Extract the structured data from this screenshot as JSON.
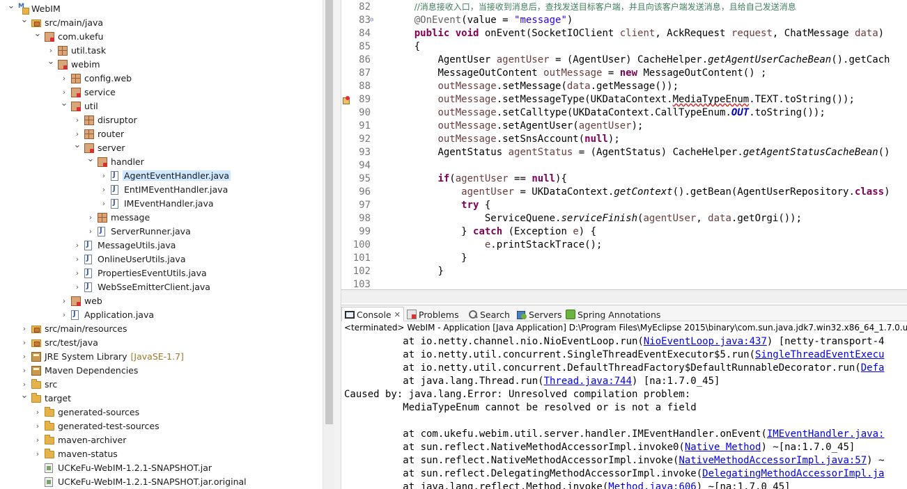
{
  "explorer": {
    "rows": [
      {
        "label": "WebIM",
        "depth": 0,
        "arrow": "open",
        "icon": "project"
      },
      {
        "label": "src/main/java",
        "depth": 1,
        "arrow": "open",
        "icon": "srcfolder"
      },
      {
        "label": "com.ukefu",
        "depth": 2,
        "arrow": "open",
        "icon": "pkgx"
      },
      {
        "label": "util.task",
        "depth": 3,
        "arrow": "closed",
        "icon": "pkg"
      },
      {
        "label": "webim",
        "depth": 3,
        "arrow": "open",
        "icon": "pkgx"
      },
      {
        "label": "config.web",
        "depth": 4,
        "arrow": "closed",
        "icon": "pkg"
      },
      {
        "label": "service",
        "depth": 4,
        "arrow": "closed",
        "icon": "pkgx"
      },
      {
        "label": "util",
        "depth": 4,
        "arrow": "open",
        "icon": "pkgx"
      },
      {
        "label": "disruptor",
        "depth": 5,
        "arrow": "closed",
        "icon": "pkg"
      },
      {
        "label": "router",
        "depth": 5,
        "arrow": "closed",
        "icon": "pkg"
      },
      {
        "label": "server",
        "depth": 5,
        "arrow": "open",
        "icon": "pkgx"
      },
      {
        "label": "handler",
        "depth": 6,
        "arrow": "open",
        "icon": "pkgx"
      },
      {
        "label": "AgentEventHandler.java",
        "depth": 7,
        "arrow": "closed",
        "icon": "java",
        "selected": true
      },
      {
        "label": "EntIMEventHandler.java",
        "depth": 7,
        "arrow": "closed",
        "icon": "java"
      },
      {
        "label": "IMEventHandler.java",
        "depth": 7,
        "arrow": "closed",
        "icon": "java"
      },
      {
        "label": "message",
        "depth": 6,
        "arrow": "closed",
        "icon": "pkg"
      },
      {
        "label": "ServerRunner.java",
        "depth": 6,
        "arrow": "closed",
        "icon": "java"
      },
      {
        "label": "MessageUtils.java",
        "depth": 5,
        "arrow": "closed",
        "icon": "java"
      },
      {
        "label": "OnlineUserUtils.java",
        "depth": 5,
        "arrow": "closed",
        "icon": "java"
      },
      {
        "label": "PropertiesEventUtils.java",
        "depth": 5,
        "arrow": "closed",
        "icon": "java"
      },
      {
        "label": "WebSseEmitterClient.java",
        "depth": 5,
        "arrow": "closed",
        "icon": "java"
      },
      {
        "label": "web",
        "depth": 4,
        "arrow": "closed",
        "icon": "pkgx"
      },
      {
        "label": "Application.java",
        "depth": 4,
        "arrow": "closed",
        "icon": "java"
      },
      {
        "label": "src/main/resources",
        "depth": 1,
        "arrow": "closed",
        "icon": "srcfolder"
      },
      {
        "label": "src/test/java",
        "depth": 1,
        "arrow": "closed",
        "icon": "srcfolder"
      },
      {
        "label": "JRE System Library",
        "decoration": "[JavaSE-1.7]",
        "depth": 1,
        "arrow": "closed",
        "icon": "lib"
      },
      {
        "label": "Maven Dependencies",
        "depth": 1,
        "arrow": "closed",
        "icon": "lib"
      },
      {
        "label": "src",
        "depth": 1,
        "arrow": "closed",
        "icon": "folder"
      },
      {
        "label": "target",
        "depth": 1,
        "arrow": "open",
        "icon": "folder"
      },
      {
        "label": "generated-sources",
        "depth": 2,
        "arrow": "closed",
        "icon": "folder"
      },
      {
        "label": "generated-test-sources",
        "depth": 2,
        "arrow": "closed",
        "icon": "folder"
      },
      {
        "label": "maven-archiver",
        "depth": 2,
        "arrow": "closed",
        "icon": "folder"
      },
      {
        "label": "maven-status",
        "depth": 2,
        "arrow": "closed",
        "icon": "folder"
      },
      {
        "label": "UCKeFu-WebIM-1.2.1-SNAPSHOT.jar",
        "depth": 2,
        "arrow": "none",
        "icon": "jar"
      },
      {
        "label": "UCKeFu-WebIM-1.2.1-SNAPSHOT.jar.original",
        "depth": 2,
        "arrow": "none",
        "icon": "jar"
      }
    ]
  },
  "editor": {
    "lines": [
      {
        "num": "82",
        "tokens": [
          [
            "ws",
            "    "
          ],
          [
            "comment",
            "//消息接收入口，当接收到消息后，查找发送目标客户端，并且向该客户端发送消息，且给自己发送消息"
          ]
        ]
      },
      {
        "num": "83",
        "fold": true,
        "tokens": [
          [
            "ws",
            "    "
          ],
          [
            "annot",
            "@OnEvent"
          ],
          [
            "plain",
            "(value = "
          ],
          [
            "str",
            "\"message\""
          ],
          [
            "plain",
            ")"
          ]
        ]
      },
      {
        "num": "84",
        "tokens": [
          [
            "ws",
            "    "
          ],
          [
            "kw",
            "public"
          ],
          [
            "plain",
            " "
          ],
          [
            "kw",
            "void"
          ],
          [
            "plain",
            " onEvent(SocketIOClient "
          ],
          [
            "localvar",
            "client"
          ],
          [
            "plain",
            ", AckRequest "
          ],
          [
            "localvar",
            "request"
          ],
          [
            "plain",
            ", ChatMessage "
          ],
          [
            "localvar",
            "data"
          ],
          [
            "plain",
            ")"
          ]
        ]
      },
      {
        "num": "85",
        "tokens": [
          [
            "ws",
            "    "
          ],
          [
            "plain",
            "{"
          ]
        ]
      },
      {
        "num": "86",
        "tokens": [
          [
            "ws",
            "        "
          ],
          [
            "plain",
            "AgentUser "
          ],
          [
            "localvar",
            "agentUser"
          ],
          [
            "plain",
            " = (AgentUser) CacheHelper."
          ],
          [
            "static",
            "getAgentUserCacheBean"
          ],
          [
            "plain",
            "().getCach"
          ]
        ]
      },
      {
        "num": "87",
        "tokens": [
          [
            "ws",
            "        "
          ],
          [
            "plain",
            "MessageOutContent "
          ],
          [
            "localvar",
            "outMessage"
          ],
          [
            "plain",
            " = "
          ],
          [
            "kw",
            "new"
          ],
          [
            "plain",
            " MessageOutContent() ;"
          ]
        ]
      },
      {
        "num": "88",
        "tokens": [
          [
            "ws",
            "        "
          ],
          [
            "localvar",
            "outMessage"
          ],
          [
            "plain",
            ".setMessage("
          ],
          [
            "localvar",
            "data"
          ],
          [
            "plain",
            ".getMessage());"
          ]
        ]
      },
      {
        "num": "89",
        "error": true,
        "tokens": [
          [
            "ws",
            "        "
          ],
          [
            "localvar",
            "outMessage"
          ],
          [
            "plain",
            ".setMessageType(UKDataContext."
          ],
          [
            "err",
            "MediaTypeEnum"
          ],
          [
            "plain",
            ".TEXT.toString());"
          ]
        ]
      },
      {
        "num": "90",
        "tokens": [
          [
            "ws",
            "        "
          ],
          [
            "localvar",
            "outMessage"
          ],
          [
            "plain",
            ".setCalltype(UKDataContext.CallTypeEnum."
          ],
          [
            "staticfield",
            "OUT"
          ],
          [
            "plain",
            ".toString());"
          ]
        ]
      },
      {
        "num": "91",
        "tokens": [
          [
            "ws",
            "        "
          ],
          [
            "localvar",
            "outMessage"
          ],
          [
            "plain",
            ".setAgentUser("
          ],
          [
            "localvar",
            "agentUser"
          ],
          [
            "plain",
            ");"
          ]
        ]
      },
      {
        "num": "92",
        "tokens": [
          [
            "ws",
            "        "
          ],
          [
            "localvar",
            "outMessage"
          ],
          [
            "plain",
            ".setSnsAccount("
          ],
          [
            "kw",
            "null"
          ],
          [
            "plain",
            ");"
          ]
        ]
      },
      {
        "num": "93",
        "tokens": [
          [
            "ws",
            "        "
          ],
          [
            "plain",
            "AgentStatus "
          ],
          [
            "localvar",
            "agentStatus"
          ],
          [
            "plain",
            " = (AgentStatus) CacheHelper."
          ],
          [
            "static",
            "getAgentStatusCacheBean"
          ],
          [
            "plain",
            "()"
          ]
        ]
      },
      {
        "num": "94",
        "tokens": []
      },
      {
        "num": "95",
        "tokens": [
          [
            "ws",
            "        "
          ],
          [
            "kw",
            "if"
          ],
          [
            "plain",
            "("
          ],
          [
            "localvar",
            "agentUser"
          ],
          [
            "plain",
            " == "
          ],
          [
            "kw",
            "null"
          ],
          [
            "plain",
            "){"
          ]
        ]
      },
      {
        "num": "96",
        "tokens": [
          [
            "ws",
            "            "
          ],
          [
            "localvar",
            "agentUser"
          ],
          [
            "plain",
            " = UKDataContext."
          ],
          [
            "static",
            "getContext"
          ],
          [
            "plain",
            "().getBean(AgentUserRepository."
          ],
          [
            "kw",
            "class"
          ],
          [
            "plain",
            ")"
          ]
        ]
      },
      {
        "num": "97",
        "tokens": [
          [
            "ws",
            "            "
          ],
          [
            "kw",
            "try"
          ],
          [
            "plain",
            " {"
          ]
        ]
      },
      {
        "num": "98",
        "tokens": [
          [
            "ws",
            "                "
          ],
          [
            "plain",
            "ServiceQuene."
          ],
          [
            "static",
            "serviceFinish"
          ],
          [
            "plain",
            "("
          ],
          [
            "localvar",
            "agentUser"
          ],
          [
            "plain",
            ", "
          ],
          [
            "localvar",
            "data"
          ],
          [
            "plain",
            ".getOrgi());"
          ]
        ]
      },
      {
        "num": "99",
        "tokens": [
          [
            "ws",
            "            "
          ],
          [
            "plain",
            "} "
          ],
          [
            "kw",
            "catch"
          ],
          [
            "plain",
            " (Exception "
          ],
          [
            "localvar",
            "e"
          ],
          [
            "plain",
            ") {"
          ]
        ]
      },
      {
        "num": "100",
        "tokens": [
          [
            "ws",
            "                "
          ],
          [
            "localvar",
            "e"
          ],
          [
            "plain",
            ".printStackTrace();"
          ]
        ]
      },
      {
        "num": "101",
        "tokens": [
          [
            "ws",
            "            "
          ],
          [
            "plain",
            "}"
          ]
        ]
      },
      {
        "num": "102",
        "tokens": [
          [
            "ws",
            "        "
          ],
          [
            "plain",
            "}"
          ]
        ]
      },
      {
        "num": "103",
        "tokens": []
      }
    ]
  },
  "console": {
    "tabs": [
      {
        "label": "Console",
        "icon": "console",
        "active": true,
        "closable": true
      },
      {
        "label": "Problems",
        "icon": "problems"
      },
      {
        "label": "Search",
        "icon": "search"
      },
      {
        "label": "Servers",
        "icon": "servers"
      },
      {
        "label": "Spring Annotations",
        "icon": "spring"
      }
    ],
    "close_glyph": "✕",
    "header": "<terminated> WebIM - Application [Java Application] D:\\Program Files\\MyEclipse 2015\\binary\\com.sun.java.jdk7.win32.x86_64_1.7.0.u45\\bin",
    "lines": [
      {
        "pre": "\tat io.netty.channel.nio.NioEventLoop.run(",
        "link": "NioEventLoop.java:437",
        "post": ") [netty-transport-4"
      },
      {
        "pre": "\tat io.netty.util.concurrent.SingleThreadEventExecutor$5.run(",
        "link": "SingleThreadEventExecu",
        "post": ""
      },
      {
        "pre": "\tat io.netty.util.concurrent.DefaultThreadFactory$DefaultRunnableDecorator.run(",
        "link": "Defa",
        "post": ""
      },
      {
        "pre": "\tat java.lang.Thread.run(",
        "link": "Thread.java:744",
        "post": ") [na:1.7.0_45]"
      },
      {
        "pre": "Caused by: java.lang.Error: Unresolved compilation problem: ",
        "link": "",
        "post": ""
      },
      {
        "pre": "\tMediaTypeEnum cannot be resolved or is not a field",
        "link": "",
        "post": ""
      },
      {
        "pre": "",
        "link": "",
        "post": ""
      },
      {
        "pre": "\tat com.ukefu.webim.util.server.handler.IMEventHandler.onEvent(",
        "link": "IMEventHandler.java:",
        "post": ""
      },
      {
        "pre": "\tat sun.reflect.NativeMethodAccessorImpl.invoke0(",
        "link": "Native Method",
        "post": ") ~[na:1.7.0_45]"
      },
      {
        "pre": "\tat sun.reflect.NativeMethodAccessorImpl.invoke(",
        "link": "NativeMethodAccessorImpl.java:57",
        "post": ") ~"
      },
      {
        "pre": "\tat sun.reflect.DelegatingMethodAccessorImpl.invoke(",
        "link": "DelegatingMethodAccessorImpl.ja",
        "post": ""
      },
      {
        "pre": "\tat java.lang.reflect.Method.invoke(",
        "link": "Method.java:606",
        "post": ") ~[na:1.7.0_45]"
      }
    ]
  }
}
